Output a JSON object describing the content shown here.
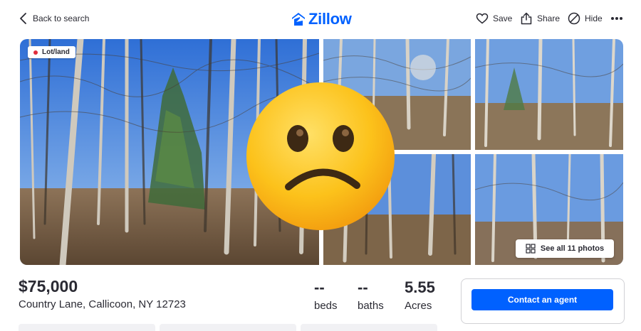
{
  "header": {
    "back_label": "Back to search",
    "logo_text": "Zillow",
    "actions": {
      "save": "Save",
      "share": "Share",
      "hide": "Hide"
    }
  },
  "gallery": {
    "badge": "Lot/land",
    "see_all": "See all 11 photos"
  },
  "listing": {
    "price": "$75,000",
    "address": "Country Lane, Callicoon, NY 12723",
    "facts": {
      "beds_value": "--",
      "beds_label": "beds",
      "baths_value": "--",
      "baths_label": "baths",
      "acres_value": "5.55",
      "acres_label": "Acres"
    },
    "contact_button": "Contact an agent"
  },
  "colors": {
    "brand": "#0061ff",
    "text": "#2a2a33",
    "badge_dot": "#e02d3c"
  },
  "icons": [
    "chevron-left-icon",
    "zillow-logo-icon",
    "heart-icon",
    "share-icon",
    "hide-icon",
    "more-icon",
    "grid-icon",
    "confused-face-emoji"
  ]
}
